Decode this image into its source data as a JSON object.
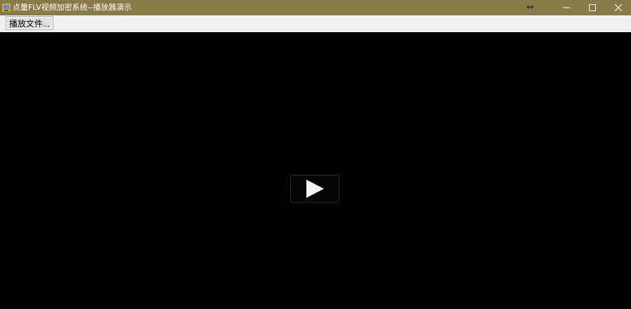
{
  "window": {
    "title": "点量FLV视频加密系统--播放器演示",
    "title_bar_color": "#8a7a48"
  },
  "titlebar": {
    "app_icon": "app-icon",
    "resize_hint_icon": "horizontal-resize-cursor-icon",
    "resize_hint_glyph": "↔",
    "minimize_icon": "minimize-icon",
    "maximize_icon": "maximize-icon",
    "close_icon": "close-icon"
  },
  "toolbar": {
    "play_file_label": "播放文件..."
  },
  "player": {
    "background": "#000000",
    "center_icon": "play-icon"
  }
}
